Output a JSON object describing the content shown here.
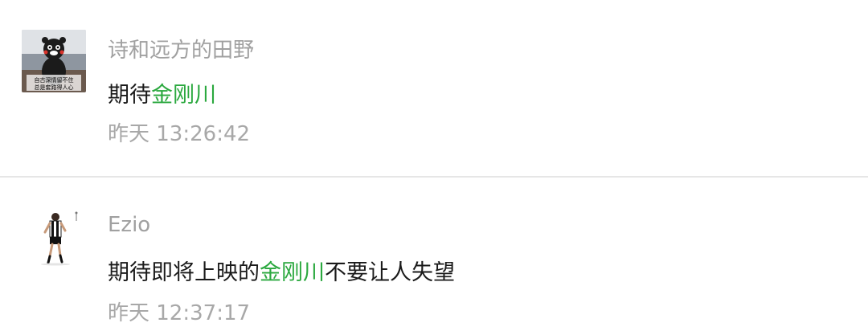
{
  "comments": [
    {
      "username": "诗和远方的田野",
      "content": {
        "before": "期待",
        "tag": "金刚川",
        "after": ""
      },
      "time": "昨天 13:26:42",
      "avatar_icon": "kumamon-bear-avatar",
      "avatar_caption_line1": "自古深情留不住",
      "avatar_caption_line2": "总是套路得人心"
    },
    {
      "username": "Ezio",
      "content": {
        "before": "期待即将上映的",
        "tag": "金刚川",
        "after": "不要让人失望"
      },
      "time": "昨天 12:37:17",
      "avatar_icon": "footballer-avatar"
    }
  ],
  "colors": {
    "tag": "#2aa83e",
    "username": "#a0a0a0",
    "time": "#a8a8a8",
    "divider": "#e6e6e6"
  }
}
